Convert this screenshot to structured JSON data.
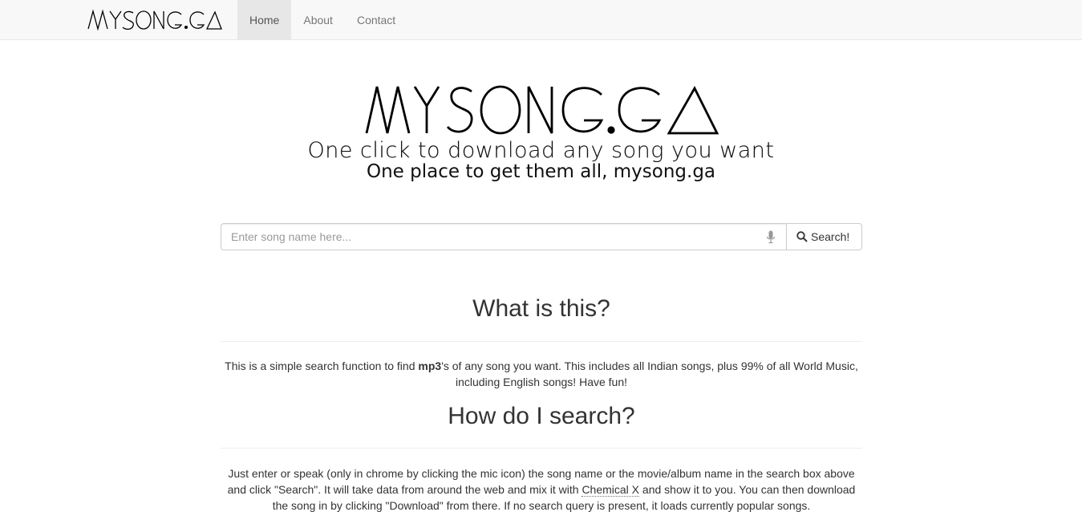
{
  "navbar": {
    "brand": "MYSONG.GA",
    "items": [
      {
        "label": "Home",
        "active": true
      },
      {
        "label": "About",
        "active": false
      },
      {
        "label": "Contact",
        "active": false
      }
    ]
  },
  "hero": {
    "logo_text": "MYSONG.GA",
    "tagline_1": "One click to download any song you want",
    "tagline_2": "One place to get them all, mysong.ga"
  },
  "search": {
    "placeholder": "Enter song name here...",
    "button_label": "Search!",
    "mic_icon": "microphone-icon",
    "search_icon": "magnifier-icon"
  },
  "what_is_this": {
    "heading": "What is this?",
    "text_1": "This is a simple search function to find ",
    "text_bold": "mp3",
    "text_2": "'s of any song you want. This includes all Indian songs, plus 99% of all World Music, including English songs! Have fun!"
  },
  "how_to_search": {
    "heading": "How do I search?",
    "text_1": "Just enter or speak (only in chrome by clicking the mic icon) the song name or the movie/album name in the search box above and click \"Search\". It will take data from around the web and mix it with ",
    "link_text": "Chemical X",
    "text_2": " and show it to you. You can then download the song in by clicking \"Download\" from there. If no search query is present, it loads currently popular songs."
  },
  "colors": {
    "navbar_bg": "#f8f8f8",
    "nav_active_bg": "#e7e7e7",
    "text": "#333333"
  }
}
